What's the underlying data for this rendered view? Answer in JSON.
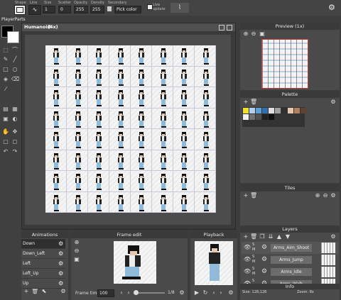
{
  "toolbar": {
    "shape_label": "Shape",
    "line_label": "Line",
    "size_label": "Size",
    "size_value": "1",
    "scatter_label": "Scatter",
    "scatter_value": "0",
    "opacity_label": "Opacity",
    "opacity_value": "255",
    "density_label": "Density",
    "density_value": "255",
    "secondary_label": "Secondary",
    "secondary_value": "Pick color",
    "live_update_label": "Live update"
  },
  "left": {
    "project_name": "PlayerParts"
  },
  "canvas": {
    "title": "Humanoid",
    "zoom": "(4x)"
  },
  "preview": {
    "title": "Preview (1x)"
  },
  "palette": {
    "title": "Palette",
    "colors": [
      "#f0e030",
      "#b0d0f0",
      "#60a0d0",
      "#3070b0",
      "#e0e0e0",
      "#a0a0a0",
      "#303030",
      "#e6c7b0",
      "#b08060",
      "#604030",
      "#f0f0f0",
      "#707070",
      "#505050",
      "#202020",
      "#101010"
    ]
  },
  "tiles": {
    "title": "Tiles"
  },
  "layers": {
    "title": "Layers",
    "items": [
      {
        "name": "Arms_Aim_Shoot"
      },
      {
        "name": "Arms_Jump"
      },
      {
        "name": "Arms_Idle"
      },
      {
        "name": "Arms_Walk"
      }
    ],
    "s_label": "S",
    "m_label": "M"
  },
  "animations": {
    "title": "Animations",
    "items": [
      {
        "name": "Down"
      },
      {
        "name": "Down_Left"
      },
      {
        "name": "Left"
      },
      {
        "name": "Left_Up"
      },
      {
        "name": "Up"
      }
    ]
  },
  "frame_edit": {
    "title": "Frame edit",
    "frame_time_label": "Frame time",
    "frame_time_value": "100",
    "frame_counter": "1/8"
  },
  "playback": {
    "title": "Playback"
  },
  "info": {
    "title": "Info",
    "size_text": "Size: 128,128",
    "zoom_text": "Zoom: 8x"
  }
}
